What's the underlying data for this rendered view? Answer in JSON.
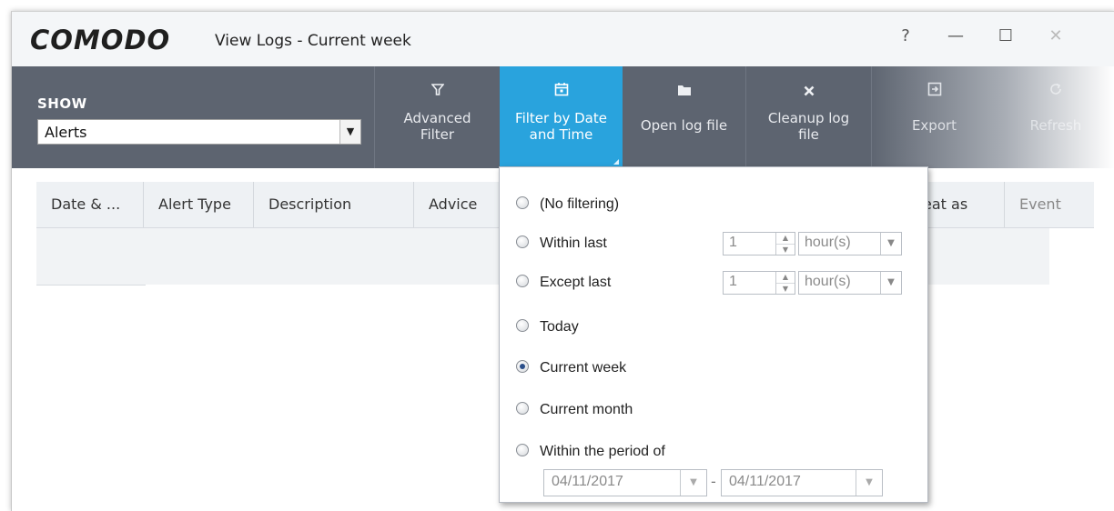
{
  "titlebar": {
    "logo": "COMODO",
    "title": "View Logs - Current week",
    "help": "?",
    "minimize": "—",
    "maximize": "☐",
    "close": "✕"
  },
  "toolbar": {
    "show_label": "SHOW",
    "show_value": "Alerts",
    "buttons": [
      {
        "id": "advanced-filter",
        "line1": "Advanced",
        "line2": "Filter",
        "icon": "filter-icon"
      },
      {
        "id": "filter-date",
        "line1": "Filter by Date",
        "line2": "and Time",
        "icon": "calendar-icon",
        "active": true
      },
      {
        "id": "open-log",
        "line1": "Open log file",
        "line2": "",
        "icon": "folder-icon"
      },
      {
        "id": "cleanup",
        "line1": "Cleanup log",
        "line2": "file",
        "icon": "x-icon"
      },
      {
        "id": "export",
        "line1": "Export",
        "line2": "",
        "icon": "export-icon"
      },
      {
        "id": "refresh",
        "line1": "Refresh",
        "line2": "",
        "icon": "refresh-icon"
      }
    ]
  },
  "table": {
    "columns": [
      "Date & ...",
      "Alert Type",
      "Description",
      "Advice",
      "eat as",
      "Event"
    ]
  },
  "filter_panel": {
    "options": [
      {
        "label": "(No filtering)",
        "selected": false
      },
      {
        "label": "Within last",
        "selected": false
      },
      {
        "label": "Except last",
        "selected": false
      },
      {
        "label": "Today",
        "selected": false
      },
      {
        "label": "Current week",
        "selected": true
      },
      {
        "label": "Current month",
        "selected": false
      },
      {
        "label": "Within the period of",
        "selected": false
      }
    ],
    "within_last": {
      "value": "1",
      "unit": "hour(s)"
    },
    "except_last": {
      "value": "1",
      "unit": "hour(s)"
    },
    "period": {
      "from": "04/11/2017",
      "separator": "-",
      "to": "04/11/2017"
    }
  },
  "colors": {
    "toolbar": "#5d6470",
    "active": "#29a3dd",
    "header": "#eef1f4"
  }
}
